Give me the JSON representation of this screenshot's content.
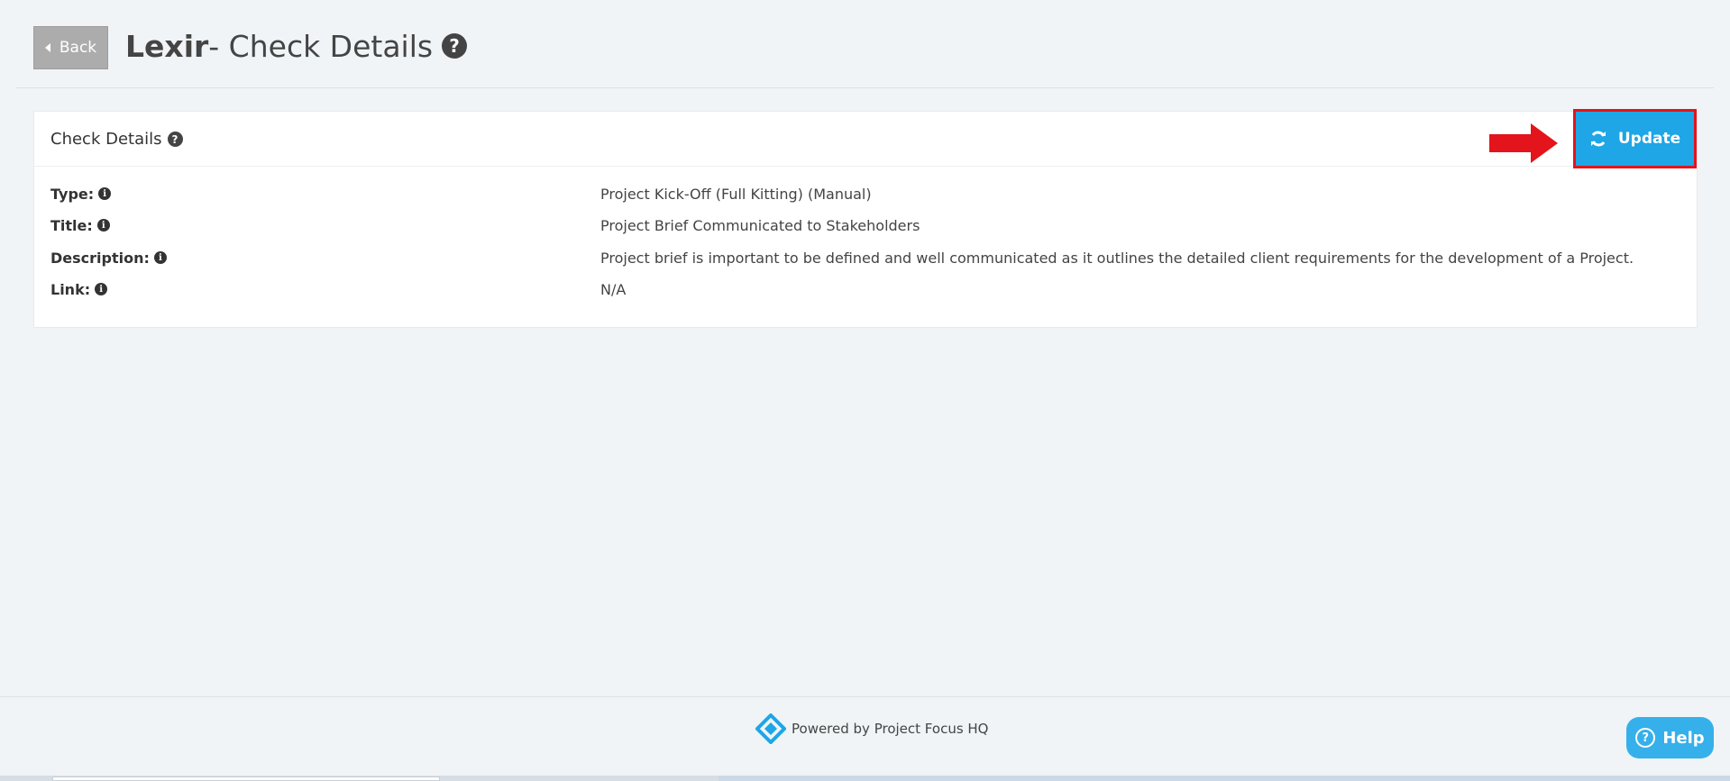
{
  "header": {
    "back_label": "Back",
    "project_name": "Lexir",
    "title_suffix": "- Check Details",
    "help_glyph": "?"
  },
  "card": {
    "title": "Check Details",
    "help_glyph": "?",
    "update_label": "Update",
    "details": [
      {
        "label": "Type:",
        "value": "Project Kick-Off (Full Kitting) (Manual)"
      },
      {
        "label": "Title:",
        "value": "Project Brief Communicated to Stakeholders"
      },
      {
        "label": "Description:",
        "value": "Project brief is important to be defined and well communicated as it outlines the detailed client requirements for the development of a Project."
      },
      {
        "label": "Link:",
        "value": "N/A"
      }
    ],
    "info_glyph": "i"
  },
  "footer": {
    "powered_text": "Powered by Project Focus HQ",
    "help_label": "Help",
    "help_glyph": "?"
  },
  "icons": {
    "back": "caret-left-icon",
    "title_help": "question-circle-icon",
    "info": "info-circle-icon",
    "update": "refresh-icon",
    "logo": "project-focus-logo-icon",
    "annotation": "red-arrow-icon"
  },
  "colors": {
    "background": "#f0f4f7",
    "update_button": "#1ea6e6",
    "highlight": "#e3141b",
    "help_button": "#36b0ea",
    "back_button": "#acacac"
  }
}
